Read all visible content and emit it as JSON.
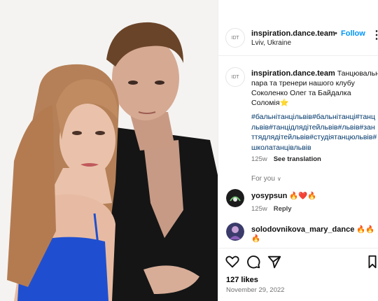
{
  "post": {
    "username": "inspiration.dance.team",
    "avatar_text": "IDT",
    "dot": "•",
    "follow_label": "Follow",
    "location": "Lviv, Ukraine",
    "more_label": "⋮"
  },
  "caption": {
    "username": "inspiration.dance.team",
    "text_lines": [
      " Танцювальна",
      "пара та тренери нашого клубу",
      "Соколенко Олег та Байдалка",
      "Соломія⭐"
    ],
    "hashtag_lines": [
      "#бальнітанцільвів#бальнітанці#танц",
      "львів#танцідлядітейльвів#львів#зан",
      "ттядлядітейльвів#студіятанцюльвів#",
      "школатанцівльвів"
    ],
    "age": "125w",
    "see_translation": "See translation"
  },
  "for_you": {
    "label": "For you",
    "chevron": "∨"
  },
  "comments": [
    {
      "username": "yosypsun",
      "text": " 🔥❤️🔥",
      "age": "125w",
      "reply_label": "Reply",
      "avatar_color": "#2a2a2a"
    },
    {
      "username": "solodovnikova_mary_dance",
      "text": " 🔥🔥",
      "text_line2": "🔥",
      "avatar_color": "#3a3b6b"
    }
  ],
  "likes": "127 likes",
  "date": "November 29, 2022",
  "colors": {
    "link_blue": "#0095f6",
    "hashtag_blue": "#00376b",
    "muted": "#737373"
  },
  "icons": [
    "heart-icon",
    "comment-icon",
    "share-icon",
    "bookmark-icon",
    "more-icon"
  ]
}
